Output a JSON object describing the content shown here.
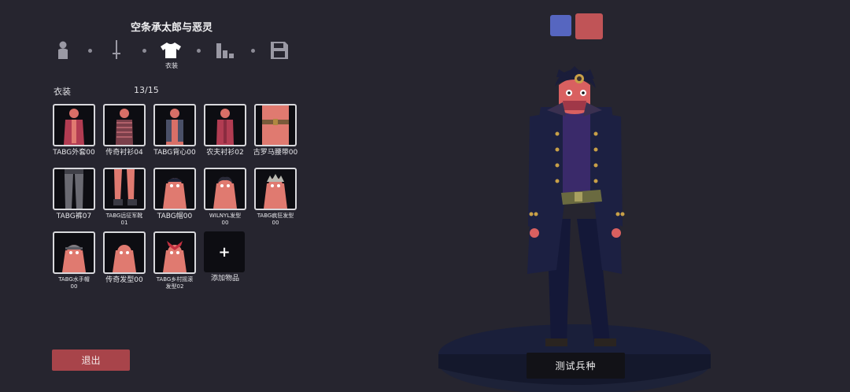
{
  "header": {
    "title": "空条承太郎与恶灵"
  },
  "tabs": [
    {
      "name": "body",
      "icon": "person-icon"
    },
    {
      "name": "weapon",
      "icon": "sword-icon"
    },
    {
      "name": "clothing",
      "icon": "shirt-icon",
      "label": "衣装",
      "active": true
    },
    {
      "name": "stats",
      "icon": "bars-icon"
    },
    {
      "name": "save",
      "icon": "save-icon"
    }
  ],
  "outfit": {
    "label": "衣装",
    "count": "13/15",
    "items": [
      {
        "label": "TABG外套00"
      },
      {
        "label": "传奇衬衫04"
      },
      {
        "label": "TABG背心00"
      },
      {
        "label": "农夫衬衫02"
      },
      {
        "label": "古罗马腰带00"
      },
      {
        "label": "TABG裤07"
      },
      {
        "label": "TABG远征军靴\n01"
      },
      {
        "label": "TABG帽00"
      },
      {
        "label": "WILNYL发型\n00"
      },
      {
        "label": "TABG疯狂发型\n00"
      },
      {
        "label": "TABG水手帽\n00"
      },
      {
        "label": "传奇发型00"
      },
      {
        "label": "TABG乡村摇滚\n发型02"
      }
    ],
    "add_label": "添加物品",
    "add_symbol": "+"
  },
  "footer": {
    "exit_label": "退出"
  },
  "preview": {
    "team_colors": [
      "#5666c0",
      "#c05457"
    ],
    "test_label": "测试兵种"
  }
}
